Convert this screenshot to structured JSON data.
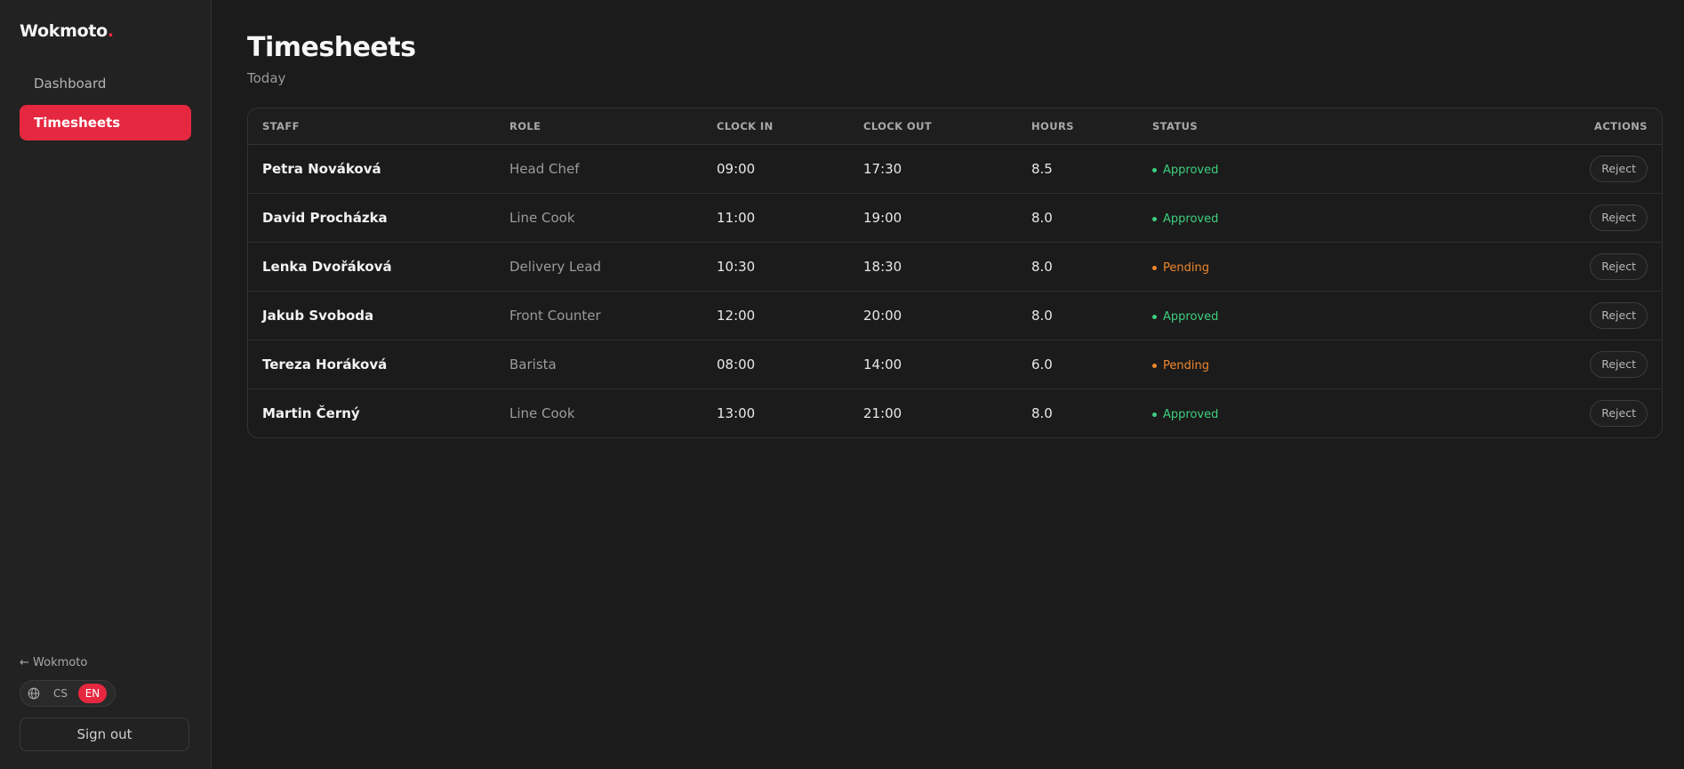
{
  "brand": {
    "name": "Wokmoto",
    "dot": ".",
    "accent": "#e5283f"
  },
  "sidebar": {
    "items": [
      {
        "label": "Dashboard",
        "active": false
      },
      {
        "label": "Timesheets",
        "active": true
      }
    ],
    "back_link": "← Wokmoto",
    "languages": [
      {
        "code": "CS",
        "active": false
      },
      {
        "code": "EN",
        "active": true
      }
    ],
    "lang_icon": "globe-icon",
    "signout_label": "Sign out"
  },
  "page": {
    "title": "Timesheets",
    "subtitle": "Today"
  },
  "table": {
    "headers": [
      "STAFF",
      "ROLE",
      "CLOCK IN",
      "CLOCK OUT",
      "HOURS",
      "STATUS",
      "ACTIONS"
    ],
    "rows": [
      {
        "staff": "Petra Nováková",
        "role": "Head Chef",
        "clock_in": "09:00",
        "clock_out": "17:30",
        "hours": "8.5",
        "status": "Approved",
        "action": "Reject"
      },
      {
        "staff": "David Procházka",
        "role": "Line Cook",
        "clock_in": "11:00",
        "clock_out": "19:00",
        "hours": "8.0",
        "status": "Approved",
        "action": "Reject"
      },
      {
        "staff": "Lenka Dvořáková",
        "role": "Delivery Lead",
        "clock_in": "10:30",
        "clock_out": "18:30",
        "hours": "8.0",
        "status": "Pending",
        "action": "Reject"
      },
      {
        "staff": "Jakub Svoboda",
        "role": "Front Counter",
        "clock_in": "12:00",
        "clock_out": "20:00",
        "hours": "8.0",
        "status": "Approved",
        "action": "Reject"
      },
      {
        "staff": "Tereza Horáková",
        "role": "Barista",
        "clock_in": "08:00",
        "clock_out": "14:00",
        "hours": "6.0",
        "status": "Pending",
        "action": "Reject"
      },
      {
        "staff": "Martin Černý",
        "role": "Line Cook",
        "clock_in": "13:00",
        "clock_out": "21:00",
        "hours": "8.0",
        "status": "Approved",
        "action": "Reject"
      }
    ]
  },
  "status_colors": {
    "Approved": "#3ecf7e",
    "Pending": "#f0872e"
  }
}
